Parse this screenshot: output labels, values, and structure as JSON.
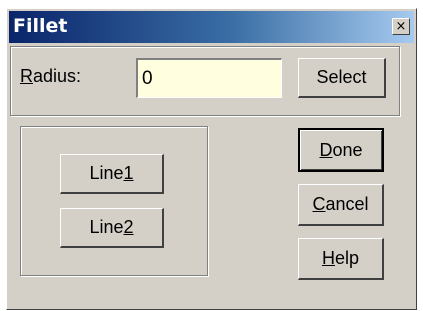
{
  "window": {
    "title": "Fillet",
    "close_glyph": "×"
  },
  "radius": {
    "label_accel": "R",
    "label_rest": "adius:",
    "value": "0",
    "select_label": "Select"
  },
  "lines": {
    "line1_prefix": "Line",
    "line1_accel": "1",
    "line2_prefix": "Line",
    "line2_accel": "2"
  },
  "actions": {
    "done_accel": "D",
    "done_rest": "one",
    "cancel_accel": "C",
    "cancel_rest": "ancel",
    "help_accel": "H",
    "help_rest": "elp"
  },
  "colors": {
    "title_gradient_start": "#0a246a",
    "title_gradient_end": "#a6caf0",
    "face": "#d4d0c8",
    "field_bg": "#ffffe0"
  }
}
